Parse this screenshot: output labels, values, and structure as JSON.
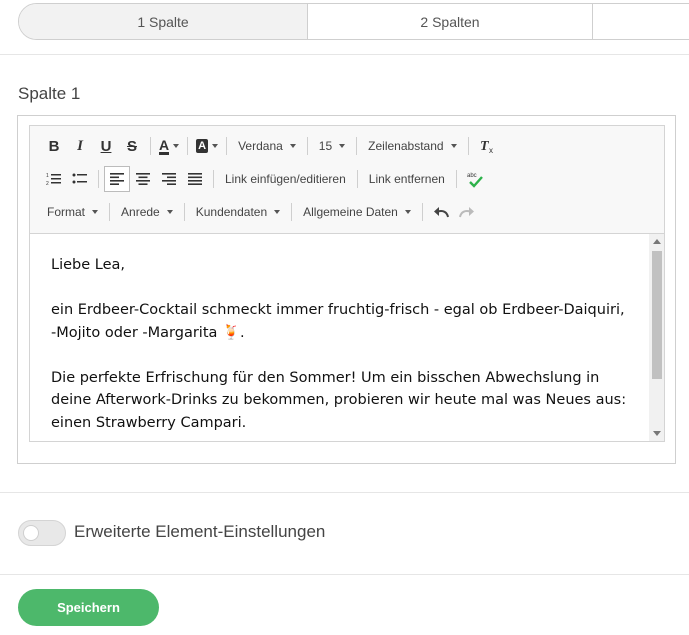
{
  "tabs": [
    {
      "label": "1 Spalte"
    },
    {
      "label": "2 Spalten"
    },
    {
      "label": ""
    }
  ],
  "section": {
    "title": "Spalte 1"
  },
  "toolbar": {
    "font_name": "Verdana",
    "font_size": "15",
    "line_spacing": "Zeilenabstand",
    "link_insert": "Link einfügen/editieren",
    "link_remove": "Link entfernen",
    "format": "Format",
    "salutation": "Anrede",
    "customer_data": "Kundendaten",
    "general_data": "Allgemeine Daten",
    "bold": "B",
    "italic": "I",
    "underline": "U",
    "strike": "S",
    "font_color": "A",
    "bg_color": "A",
    "spell_label": "abc"
  },
  "content": {
    "greeting": "Liebe Lea,",
    "para1": "ein Erdbeer-Cocktail schmeckt immer fruchtig-frisch - egal ob Erdbeer-Daiquiri, -Mojito oder -Margarita 🍹.",
    "para2": "Die perfekte Erfrischung für den Sommer! Um ein bisschen Abwechslung in deine Afterwork-Drinks zu bekommen, probieren wir heute mal was Neues aus: einen Strawberry Campari."
  },
  "settings": {
    "toggle_label": "Erweiterte Element-Einstellungen",
    "toggle_on": false
  },
  "actions": {
    "save_label": "Speichern"
  },
  "colors": {
    "accent": "#4db86b",
    "border": "#cfcfcf"
  }
}
